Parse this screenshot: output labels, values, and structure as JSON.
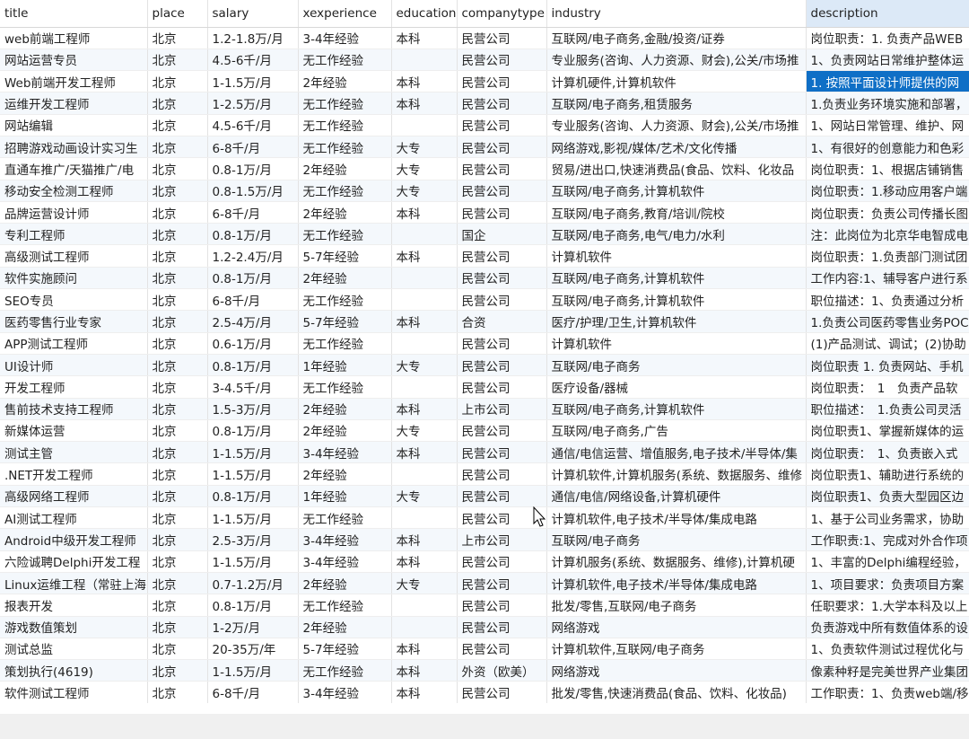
{
  "columns": [
    "title",
    "place",
    "salary",
    "xexperience",
    "education",
    "companytype",
    "industry",
    "description"
  ],
  "rows": [
    [
      "web前端工程师",
      "北京",
      "1.2-1.8万/月",
      "3-4年经验",
      "本科",
      "民营公司",
      "互联网/电子商务,金融/投资/证券",
      "岗位职责：1. 负责产品WEB"
    ],
    [
      "网站运营专员",
      "北京",
      "4.5-6千/月",
      "无工作经验",
      "",
      "民营公司",
      "专业服务(咨询、人力资源、财会),公关/市场推",
      "1、负责网站日常维护整体运"
    ],
    [
      "Web前端开发工程师",
      "北京",
      "1-1.5万/月",
      "2年经验",
      "本科",
      "民营公司",
      "计算机硬件,计算机软件",
      "1. 按照平面设计师提供的网"
    ],
    [
      "运维开发工程师",
      "北京",
      "1-2.5万/月",
      "无工作经验",
      "本科",
      "民营公司",
      "互联网/电子商务,租赁服务",
      "1.负责业务环境实施和部署，"
    ],
    [
      "网站编辑",
      "北京",
      "4.5-6千/月",
      "无工作经验",
      "",
      "民营公司",
      "专业服务(咨询、人力资源、财会),公关/市场推",
      "1、网站日常管理、维护、网"
    ],
    [
      "招聘游戏动画设计实习生",
      "北京",
      "6-8千/月",
      "无工作经验",
      "大专",
      "民营公司",
      "网络游戏,影视/媒体/艺术/文化传播",
      "1、有很好的创意能力和色彩"
    ],
    [
      "直通车推广/天猫推广/电",
      "北京",
      "0.8-1万/月",
      "2年经验",
      "大专",
      "民营公司",
      "贸易/进出口,快速消费品(食品、饮料、化妆品",
      "岗位职责：1、根据店铺销售"
    ],
    [
      "移动安全检测工程师",
      "北京",
      "0.8-1.5万/月",
      "无工作经验",
      "大专",
      "民营公司",
      "互联网/电子商务,计算机软件",
      "岗位职责：1.移动应用客户端"
    ],
    [
      "品牌运营设计师",
      "北京",
      "6-8千/月",
      "2年经验",
      "本科",
      "民营公司",
      "互联网/电子商务,教育/培训/院校",
      "岗位职责：负责公司传播长图"
    ],
    [
      "专利工程师",
      "北京",
      "0.8-1万/月",
      "无工作经验",
      "",
      "国企",
      "互联网/电子商务,电气/电力/水利",
      "注：此岗位为北京华电智成电"
    ],
    [
      "高级测试工程师",
      "北京",
      "1.2-2.4万/月",
      "5-7年经验",
      "本科",
      "民营公司",
      "计算机软件",
      "岗位职责：1.负责部门测试团"
    ],
    [
      "软件实施顾问",
      "北京",
      "0.8-1万/月",
      "2年经验",
      "",
      "民营公司",
      "互联网/电子商务,计算机软件",
      "工作内容:1、辅导客户进行系"
    ],
    [
      "SEO专员",
      "北京",
      "6-8千/月",
      "无工作经验",
      "",
      "民营公司",
      "互联网/电子商务,计算机软件",
      "职位描述：1、负责通过分析"
    ],
    [
      "医药零售行业专家",
      "北京",
      "2.5-4万/月",
      "5-7年经验",
      "本科",
      "合资",
      "医疗/护理/卫生,计算机软件",
      "1.负责公司医药零售业务POC"
    ],
    [
      "APP测试工程师",
      "北京",
      "0.6-1万/月",
      "无工作经验",
      "",
      "民营公司",
      "计算机软件",
      "(1)产品测试、调试；(2)协助"
    ],
    [
      "UI设计师",
      "北京",
      "0.8-1万/月",
      "1年经验",
      "大专",
      "民营公司",
      "互联网/电子商务",
      "岗位职责 1. 负责网站、手机"
    ],
    [
      "开发工程师",
      "北京",
      "3-4.5千/月",
      "无工作经验",
      "",
      "民营公司",
      "医疗设备/器械",
      "岗位职责：　1　负责产品软"
    ],
    [
      "售前技术支持工程师",
      "北京",
      "1.5-3万/月",
      "2年经验",
      "本科",
      "上市公司",
      "互联网/电子商务,计算机软件",
      "职位描述：　1.负责公司灵活"
    ],
    [
      "新媒体运营",
      "北京",
      "0.8-1万/月",
      "2年经验",
      "大专",
      "民营公司",
      "互联网/电子商务,广告",
      "岗位职责1、掌握新媒体的运"
    ],
    [
      "测试主管",
      "北京",
      "1-1.5万/月",
      "3-4年经验",
      "本科",
      "民营公司",
      "通信/电信运营、增值服务,电子技术/半导体/集",
      "岗位职责：　1、负责嵌入式"
    ],
    [
      ".NET开发工程师",
      "北京",
      "1-1.5万/月",
      "2年经验",
      "",
      "民营公司",
      "计算机软件,计算机服务(系统、数据服务、维修",
      "岗位职责1、辅助进行系统的"
    ],
    [
      "高级网络工程师",
      "北京",
      "0.8-1万/月",
      "1年经验",
      "大专",
      "民营公司",
      "通信/电信/网络设备,计算机硬件",
      "岗位职责1、负责大型园区边"
    ],
    [
      "AI测试工程师",
      "北京",
      "1-1.5万/月",
      "无工作经验",
      "",
      "民营公司",
      "计算机软件,电子技术/半导体/集成电路",
      "1、基于公司业务需求，协助"
    ],
    [
      "Android中级开发工程师",
      "北京",
      "2.5-3万/月",
      "3-4年经验",
      "本科",
      "上市公司",
      "互联网/电子商务",
      "工作职责:1、完成对外合作项"
    ],
    [
      "六险诚聘Delphi开发工程",
      "北京",
      "1-1.5万/月",
      "3-4年经验",
      "本科",
      "民营公司",
      "计算机服务(系统、数据服务、维修),计算机硬",
      "1、丰富的Delphi编程经验，"
    ],
    [
      "Linux运维工程（常驻上海",
      "北京",
      "0.7-1.2万/月",
      "2年经验",
      "大专",
      "民营公司",
      "计算机软件,电子技术/半导体/集成电路",
      "1、项目要求：负责项目方案"
    ],
    [
      "报表开发",
      "北京",
      "0.8-1万/月",
      "无工作经验",
      "",
      "民营公司",
      "批发/零售,互联网/电子商务",
      "任职要求：1.大学本科及以上"
    ],
    [
      "游戏数值策划",
      "北京",
      "1-2万/月",
      "2年经验",
      "",
      "民营公司",
      "网络游戏",
      "负责游戏中所有数值体系的设"
    ],
    [
      "测试总监",
      "北京",
      "20-35万/年",
      "5-7年经验",
      "本科",
      "民营公司",
      "计算机软件,互联网/电子商务",
      "1、负责软件测试过程优化与"
    ],
    [
      "策划执行(4619)",
      "北京",
      "1-1.5万/月",
      "无工作经验",
      "本科",
      "外资（欧美）",
      "网络游戏",
      "像素种籽是完美世界产业集团"
    ],
    [
      "软件测试工程师",
      "北京",
      "6-8千/月",
      "3-4年经验",
      "本科",
      "民营公司",
      "批发/零售,快速消费品(食品、饮料、化妆品)",
      "工作职责：1、负责web端/移"
    ]
  ],
  "selected_cell": {
    "row": 2,
    "col": 7
  },
  "sorted_column": 7,
  "colors": {
    "selection": "#0f6fc6",
    "sorted_header": "#dce9f7",
    "alt_row": "#f4f8fc"
  }
}
